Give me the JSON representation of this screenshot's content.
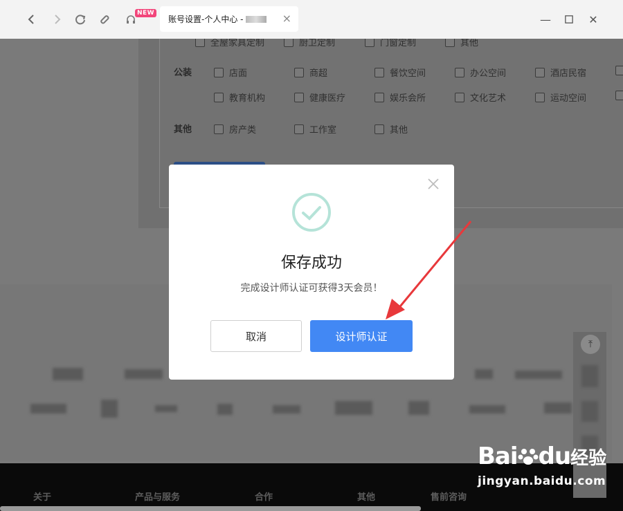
{
  "browser": {
    "tab_title": "账号设置-个人中心 - ",
    "new_badge": "NEW"
  },
  "page": {
    "row_partial": [
      "全屋家具定制",
      "厨卫定制",
      "门窗定制",
      "其他"
    ],
    "groups": [
      {
        "label": "公装",
        "options": [
          "店面",
          "商超",
          "餐饮空间",
          "办公空间",
          "酒店民宿",
          "教育机构",
          "健康医疗",
          "娱乐会所",
          "文化艺术",
          "运动空间"
        ]
      },
      {
        "label": "其他",
        "options": [
          "房产类",
          "工作室",
          "其他"
        ]
      }
    ],
    "footer_links": [
      "关于",
      "产品与服务",
      "合作",
      "其他",
      "售前咨询"
    ]
  },
  "modal": {
    "title": "保存成功",
    "message": "完成设计师认证可获得3天会员！",
    "cancel_label": "取消",
    "confirm_label": "设计师认证"
  },
  "watermark": {
    "logo_prefix": "Bai",
    "logo_suffix": "du",
    "brand_text": "经验",
    "url": "jingyan.baidu.com"
  },
  "colors": {
    "primary": "#4288f4",
    "success": "#b5e3d8",
    "annotation": "#e8383b"
  }
}
